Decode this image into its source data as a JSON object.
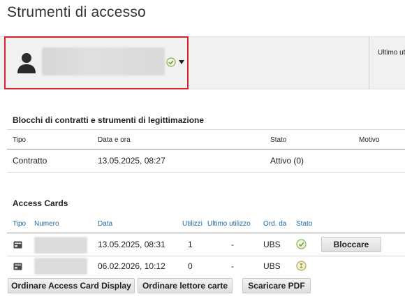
{
  "page": {
    "title": "Strumenti di accesso"
  },
  "user_bar": {
    "last_use_label": "Ultimo uti"
  },
  "blocks": {
    "title": "Blocchi di contratti e strumenti di legittimazione",
    "headers": {
      "tipo": "Tipo",
      "data": "Data e ora",
      "stato": "Stato",
      "motivo": "Motivo"
    },
    "row": {
      "tipo": "Contratto",
      "data": "13.05.2025, 08:27",
      "stato": "Attivo (0)",
      "motivo": ""
    }
  },
  "access_cards": {
    "title": "Access Cards",
    "headers": {
      "tipo": "Tipo",
      "numero": "Numero",
      "data": "Data",
      "utilizzi": "Utilizzi",
      "ultimo": "Ultimo utilizzo",
      "ord_da": "Ord. da",
      "stato": "Stato"
    },
    "rows": [
      {
        "data": "13.05.2025, 08:31",
        "utilizzi": "1",
        "ultimo": "-",
        "ord_da": "UBS",
        "status_icon": "check-circle-icon",
        "action_label": "Bloccare"
      },
      {
        "data": "06.02.2026, 10:12",
        "utilizzi": "0",
        "ultimo": "-",
        "ord_da": "UBS",
        "status_icon": "hourglass-icon",
        "action_label": ""
      }
    ]
  },
  "actions": {
    "order_display": "Ordinare Access Card Display",
    "order_reader": "Ordinare lettore carte",
    "download_pdf": "Scaricare PDF"
  },
  "colors": {
    "accent_red": "#d8232a",
    "link_blue": "#1f6aa5",
    "status_green": "#7aa83a",
    "status_olive": "#a6a24a"
  }
}
